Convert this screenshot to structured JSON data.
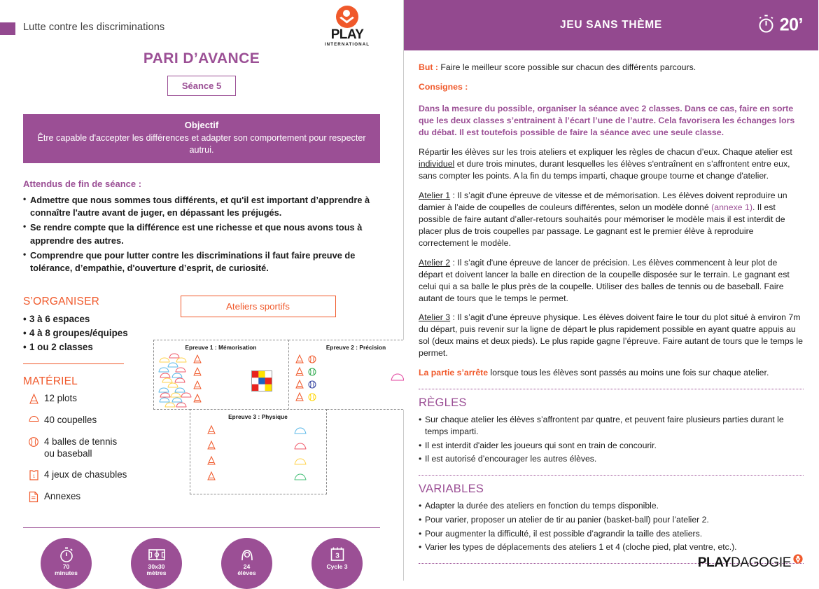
{
  "left": {
    "topbar": {
      "title": "Lutte contre les discriminations",
      "logo_word": "PLAY",
      "logo_sub": "INTERNATIONAL"
    },
    "main_title": "PARI D’AVANCE",
    "seance": "Séance 5",
    "objectif": {
      "heading": "Objectif",
      "text": "Être capable d'accepter les différences et adapter son comportement pour respecter autrui."
    },
    "attendus": {
      "heading": "Attendus de fin de séance :",
      "items": [
        "Admettre que nous sommes tous différents, et qu'il est important d’apprendre à connaître l'autre avant de juger, en dépassant les préjugés.",
        "Se rendre compte que la différence est une richesse et que nous avons tous à apprendre des autres.",
        "Comprendre que pour lutter contre les discriminations il faut faire preuve de tolérance, d’empathie, d'ouverture d’esprit, de curiosité."
      ]
    },
    "organiser": {
      "heading": "S’ORGANISER",
      "items": [
        "3 à 6 espaces",
        "4 à 8 groupes/équipes",
        "1 ou 2 classes"
      ]
    },
    "materiel": {
      "heading": "MATÉRIEL",
      "items": [
        {
          "icon": "cone-icon",
          "label": "12 plots"
        },
        {
          "icon": "coupelle-icon",
          "label": "40 coupelles"
        },
        {
          "icon": "tennis-ball-icon",
          "label": "4 balles de tennis ou baseball"
        },
        {
          "icon": "jersey-icon",
          "label": "4 jeux de chasubles"
        },
        {
          "icon": "document-icon",
          "label": "Annexes"
        }
      ]
    },
    "ateliers_button": "Ateliers sportifs",
    "diagram": {
      "ep1_label": "Epreuve 1 : Mémorisation",
      "ep2_label": "Epreuve 2 : Précision",
      "ep3_label": "Epreuve 3 : Physique",
      "checkerboard_colors": [
        [
          "#e8241f",
          "#ffe200",
          "#ffffff"
        ],
        [
          "#ffffff",
          "#1a62c4",
          "#e8241f"
        ],
        [
          "#e8241f",
          "#ffffff",
          "#ffe200"
        ]
      ],
      "ep2_ball_colors": [
        "#f0592b",
        "#2aa84a",
        "#2f3f9e",
        "#ffd400"
      ],
      "ep3_coupelle_colors": [
        "#5bb8e8",
        "#ef5b6b",
        "#ffd34d",
        "#49c07a"
      ]
    },
    "stats": [
      {
        "icon": "stopwatch-icon",
        "line1": "70",
        "line2": "minutes"
      },
      {
        "icon": "field-icon",
        "line1": "30x30",
        "line2": "mètres"
      },
      {
        "icon": "students-icon",
        "line1": "24",
        "line2": "élèves"
      },
      {
        "icon": "calendar-icon",
        "line1": "Cycle 3",
        "line2": ""
      }
    ]
  },
  "right": {
    "header": {
      "title": "JEU SANS THÈME",
      "timer": "20’",
      "timer_icon": "stopwatch-icon"
    },
    "but": {
      "label": "But :",
      "text": "Faire le meilleur score possible sur chacun des différents parcours."
    },
    "consignes_label": "Consignes :",
    "consignes_purple": "Dans la mesure du possible, organiser la séance avec 2 classes. Dans ce cas, faire en sorte que les deux classes s’entrainent à l’écart l’une de l’autre. Cela favorisera les échanges lors du débat. Il est toutefois possible de faire la séance avec une seule classe.",
    "repartir_pre": "Répartir les élèves sur les trois ateliers et expliquer les règles de chacun d’eux. Chaque atelier est ",
    "repartir_underline": "individuel",
    "repartir_post": " et dure trois minutes, durant lesquelles les élèves s'entraînent en s’affrontent entre eux, sans compter les points. A la fin du temps imparti, chaque groupe tourne et change d'atelier.",
    "atelier1": {
      "label": "Atelier 1",
      "part1": " : Il s’agit d'une épreuve de vitesse et de mémorisation. Les élèves doivent reproduire un damier à l’aide de coupelles de couleurs différentes, selon un modèle donné ",
      "annexe": "(annexe 1)",
      "part2": ". Il est possible de faire autant d’aller-retours souhaités pour mémoriser le modèle mais il est interdit de placer plus de trois coupelles par passage. Le gagnant est le premier élève à reproduire correctement le modèle."
    },
    "atelier2": {
      "label": "Atelier 2",
      "text": " : Il s’agit d'une épreuve de lancer de précision. Les élèves commencent à leur plot de départ et doivent lancer la balle en direction de la coupelle disposée sur le terrain. Le gagnant est celui qui a sa balle le plus près de la coupelle. Utiliser des balles de tennis ou de baseball. Faire autant de tours que le temps le permet."
    },
    "atelier3": {
      "label": "Atelier 3",
      "text": " : Il s’agit d’une épreuve physique. Les élèves doivent faire le tour du plot situé à environ 7m du départ, puis revenir sur la ligne de départ le plus rapidement possible en ayant quatre appuis au sol (deux mains et deux pieds). Le plus rapide gagne l’épreuve. Faire autant de tours que le temps le permet."
    },
    "arret": {
      "label": "La partie s’arrête",
      "text": " lorsque tous les élèves sont passés au moins une fois sur chaque atelier."
    },
    "regles": {
      "heading": "RÈGLES",
      "items": [
        "Sur chaque atelier les élèves s’affrontent par quatre, et peuvent faire plusieurs parties durant le temps imparti.",
        "Il est interdit d'aider les joueurs qui sont en train de concourir.",
        "Il est autorisé d’encourager les autres élèves."
      ]
    },
    "variables": {
      "heading": "VARIABLES",
      "items": [
        "Adapter la durée des ateliers en fonction du temps disponible.",
        "Pour varier, proposer un atelier de tir au panier (basket-ball) pour l’atelier 2.",
        "Pour augmenter la difficulté, il est possible d’agrandir la taille des ateliers.",
        "Varier les types de déplacements des ateliers 1 et 4 (cloche pied, plat ventre, etc.)."
      ]
    },
    "footer_logo": {
      "bold": "PLAY",
      "normal": "DAGOGIE"
    }
  },
  "colors": {
    "purple": "#9b4f95",
    "purple_dark": "#93498f",
    "orange": "#f0592b",
    "text": "#1c1c1c"
  }
}
